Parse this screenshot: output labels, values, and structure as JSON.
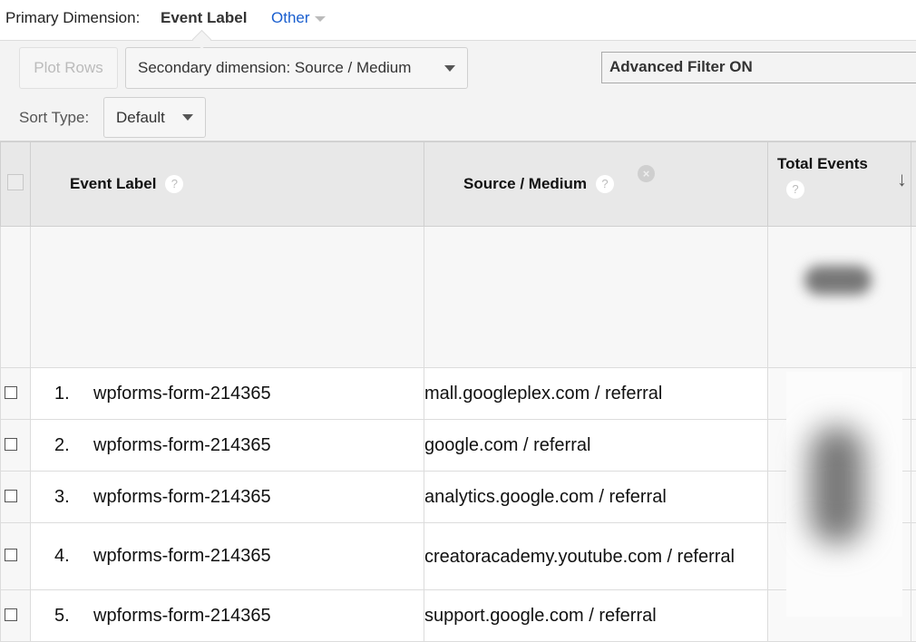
{
  "primary_dimension": {
    "label": "Primary Dimension:",
    "selected": "Event Label",
    "other": "Other"
  },
  "toolbar": {
    "plot_rows": "Plot Rows",
    "secondary_dimension": "Secondary dimension: Source / Medium",
    "sort_type_label": "Sort Type:",
    "sort_type_value": "Default",
    "advanced_filter": "Advanced Filter ON"
  },
  "table": {
    "columns": [
      {
        "label": "Event Label",
        "help": "?"
      },
      {
        "label": "Source / Medium",
        "help": "?",
        "remove": "×"
      },
      {
        "label": "Total Events",
        "help": "?",
        "sort": "↓"
      }
    ],
    "rows": [
      {
        "num": "1.",
        "event_label": "wpforms-form-214365",
        "source_medium": "mall.googleplex.com / referral"
      },
      {
        "num": "2.",
        "event_label": "wpforms-form-214365",
        "source_medium": "google.com / referral"
      },
      {
        "num": "3.",
        "event_label": "wpforms-form-214365",
        "source_medium": "analytics.google.com / referral"
      },
      {
        "num": "4.",
        "event_label": "wpforms-form-214365",
        "source_medium": "creatoracademy.youtube.com / referral"
      },
      {
        "num": "5.",
        "event_label": "wpforms-form-214365",
        "source_medium": "support.google.com / referral"
      }
    ]
  },
  "colors": {
    "link": "#1a5fcf",
    "header_bg": "#e8e8e8",
    "toolbar_bg": "#f3f3f3"
  }
}
